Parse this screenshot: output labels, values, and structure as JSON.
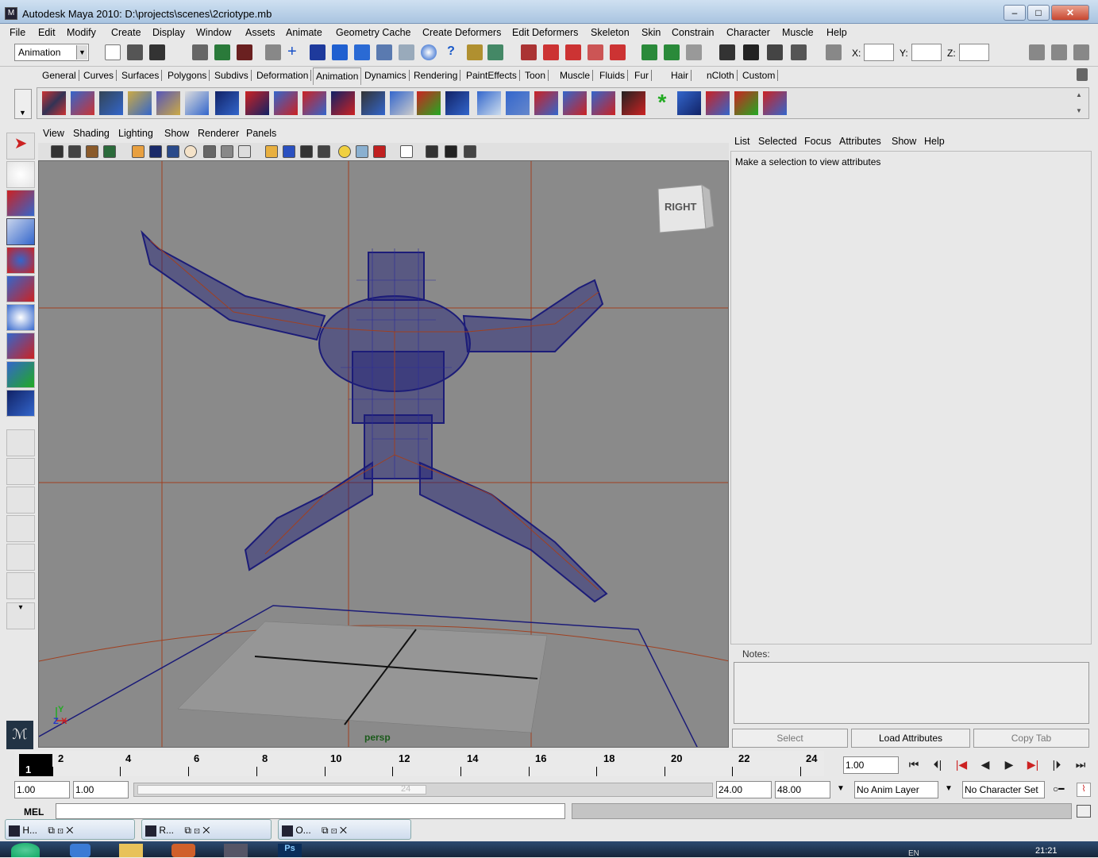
{
  "window": {
    "title": "Autodesk Maya 2010: D:\\projects\\scenes\\2criotype.mb"
  },
  "menubar": [
    "File",
    "Edit",
    "Modify",
    "Create",
    "Display",
    "Window",
    "Assets",
    "Animate",
    "Geometry Cache",
    "Create Deformers",
    "Edit Deformers",
    "Skeleton",
    "Skin",
    "Constrain",
    "Character",
    "Muscle",
    "Help"
  ],
  "status": {
    "menu_set": "Animation",
    "x_label": "X:",
    "y_label": "Y:",
    "z_label": "Z:"
  },
  "shelf_tabs": [
    "General",
    "Curves",
    "Surfaces",
    "Polygons",
    "Subdivs",
    "Deformation",
    "Animation",
    "Dynamics",
    "Rendering",
    "PaintEffects",
    "Toon",
    "Muscle",
    "Fluids",
    "Fur",
    "Hair",
    "nCloth",
    "Custom"
  ],
  "shelf_active": "Animation",
  "viewport": {
    "menu": [
      "View",
      "Shading",
      "Lighting",
      "Show",
      "Renderer",
      "Panels"
    ],
    "camera_label": "persp",
    "viewcube_label": "RIGHT",
    "axis": {
      "x": "X",
      "y": "Y",
      "z": "Z"
    }
  },
  "attr_editor": {
    "menu": [
      "List",
      "Selected",
      "Focus",
      "Attributes",
      "Show",
      "Help"
    ],
    "message": "Make a selection to view attributes",
    "notes_label": "Notes:",
    "buttons": {
      "select": "Select",
      "load": "Load Attributes",
      "copy": "Copy Tab"
    }
  },
  "timeline": {
    "current_frame": "1",
    "ticks": [
      "2",
      "4",
      "6",
      "8",
      "10",
      "12",
      "14",
      "16",
      "18",
      "20",
      "22",
      "24"
    ],
    "current_time_field": "1.00",
    "start_time": "1.00",
    "playback_start": "1.00",
    "range_marker_end": "24",
    "playback_end": "24.00",
    "end_time": "48.00",
    "anim_layer": "No Anim Layer",
    "character_set": "No Character Set"
  },
  "command_line": {
    "label": "MEL"
  },
  "taskbar_buttons": [
    {
      "label": "H..."
    },
    {
      "label": "R..."
    },
    {
      "label": "O..."
    }
  ],
  "system": {
    "lang": "EN",
    "clock": "21:21"
  },
  "colors": {
    "wireframe": "#1c1c78",
    "grid_red": "#a04020",
    "viewport_bg": "#8a8a8a",
    "title_bar": "#b8cfe8"
  }
}
